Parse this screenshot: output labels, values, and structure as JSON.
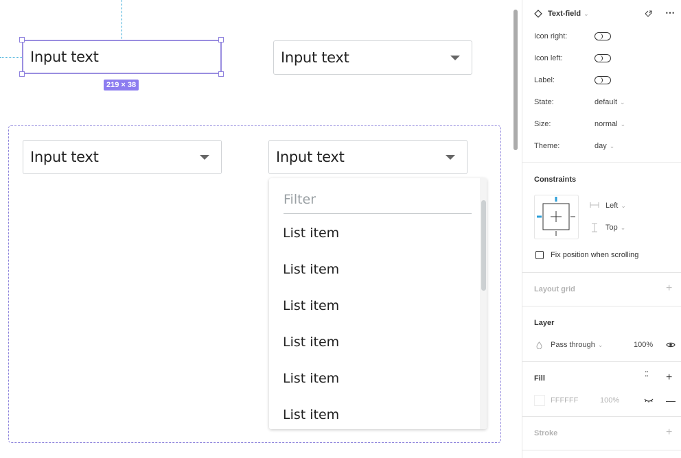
{
  "canvas": {
    "selected_field": {
      "value": "Input text",
      "size_badge": "219 × 38"
    },
    "top_right_field": {
      "value": "Input text"
    },
    "frame_field_left": {
      "value": "Input text"
    },
    "frame_field_right": {
      "value": "Input text"
    },
    "dropdown": {
      "filter_placeholder": "Filter",
      "items": [
        "List item",
        "List item",
        "List item",
        "List item",
        "List item",
        "List item"
      ]
    }
  },
  "panel": {
    "component": {
      "name": "Text-field",
      "icon": "diamond-icon"
    },
    "props": [
      {
        "label": "Icon right:",
        "type": "toggle",
        "value": "off"
      },
      {
        "label": "Icon left:",
        "type": "toggle",
        "value": "off"
      },
      {
        "label": "Label:",
        "type": "toggle",
        "value": "off"
      },
      {
        "label": "State:",
        "type": "select",
        "value": "default"
      },
      {
        "label": "Size:",
        "type": "select",
        "value": "normal"
      },
      {
        "label": "Theme:",
        "type": "select",
        "value": "day"
      }
    ],
    "constraints": {
      "title": "Constraints",
      "horizontal": "Left",
      "vertical": "Top",
      "fix_position_label": "Fix position when scrolling",
      "fix_position_checked": false
    },
    "layout_grid": {
      "title": "Layout grid"
    },
    "layer": {
      "title": "Layer",
      "blend": "Pass through",
      "opacity": "100%"
    },
    "fill": {
      "title": "Fill",
      "color": "FFFFFF",
      "opacity": "100%"
    },
    "stroke": {
      "title": "Stroke"
    }
  },
  "colors": {
    "selection": "#9a8ee0",
    "badge": "#8c7cf0",
    "guide": "#1fa0d4",
    "constraint_active": "#2d9fd8"
  }
}
